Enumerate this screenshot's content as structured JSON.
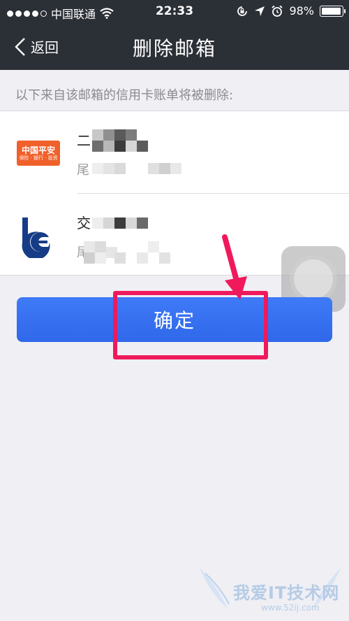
{
  "status_bar": {
    "carrier": "中国联通",
    "time": "22:33",
    "battery": "98%",
    "battery_level": 0.98
  },
  "nav": {
    "back_label": "返回",
    "title": "删除邮箱"
  },
  "section": {
    "header": "以下来自该邮箱的信用卡账单将被删除:"
  },
  "items": [
    {
      "bank_logo": "pingan-logo",
      "logo_text": "中国平安",
      "logo_subtext": "保险 · 银行 · 投资",
      "title_visible": "二",
      "subtitle_visible": "尾"
    },
    {
      "bank_logo": "bank-of-communications-logo",
      "title_visible": "交",
      "subtitle_visible": "尾"
    }
  ],
  "confirm_button": {
    "label": "确定"
  },
  "watermark": {
    "text": "我爱IT技术网",
    "url": "www.52ij.com"
  },
  "colors": {
    "nav_bg": "#2b2f36",
    "page_bg": "#efeff4",
    "primary_blue": "#3a74f4",
    "highlight_pink": "#f0195c",
    "pingan_orange": "#f0602a",
    "bcm_blue": "#173c87"
  }
}
